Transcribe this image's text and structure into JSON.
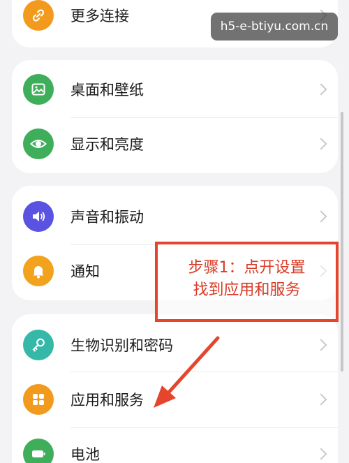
{
  "watermark": "h5-e-btiyu.com.cn",
  "settings": {
    "more_connections": "更多连接",
    "desktop_wallpaper": "桌面和壁纸",
    "display_brightness": "显示和亮度",
    "sound_vibration": "声音和振动",
    "notifications": "通知",
    "biometrics_password": "生物识别和密码",
    "apps_services": "应用和服务",
    "battery": "电池"
  },
  "callout": {
    "line1": "步骤1：点开设置",
    "line2": "找到应用和服务"
  },
  "colors": {
    "more_connections": "#f29a1d",
    "desktop_wallpaper": "#3fae5a",
    "display_brightness": "#3fae5a",
    "sound_vibration": "#5a52e0",
    "notifications": "#f2a21d",
    "biometrics_password": "#35b8a8",
    "apps_services": "#f29a1d",
    "battery": "#3fae5a",
    "annotation": "#e4452d"
  },
  "icons": {
    "more_connections": "link-icon",
    "desktop_wallpaper": "image-icon",
    "display_brightness": "eye-icon",
    "sound_vibration": "speaker-icon",
    "notifications": "bell-icon",
    "biometrics_password": "key-icon",
    "apps_services": "apps-grid-icon",
    "battery": "battery-icon"
  }
}
